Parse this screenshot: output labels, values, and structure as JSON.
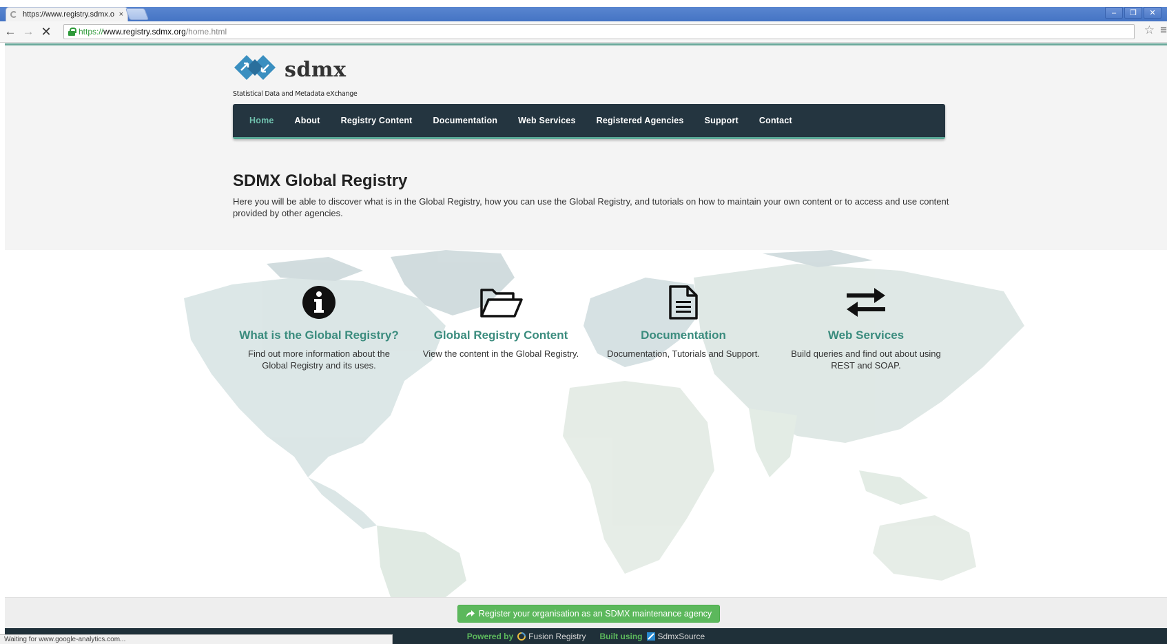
{
  "browser": {
    "tab_title": "https://www.registry.sdmx.o",
    "tab_close": "×",
    "url_scheme": "https://",
    "url_host": "www.registry.sdmx.org",
    "url_path": "/home.html",
    "status_text": "Waiting for www.google-analytics.com..."
  },
  "logo": {
    "word": "sdmx",
    "tagline": "Statistical Data and Metadata eXchange",
    "colors": {
      "mark": "#3a8fc0"
    }
  },
  "nav": {
    "items": [
      {
        "label": "Home",
        "active": true
      },
      {
        "label": "About"
      },
      {
        "label": "Registry Content"
      },
      {
        "label": "Documentation"
      },
      {
        "label": "Web Services"
      },
      {
        "label": "Registered Agencies"
      },
      {
        "label": "Support"
      },
      {
        "label": "Contact"
      }
    ]
  },
  "page": {
    "title": "SDMX Global Registry",
    "intro": "Here you will be able to discover what is in the Global Registry, how you can use the Global Registry, and tutorials on how to maintain your own content or to access and use content provided by other agencies."
  },
  "features": [
    {
      "icon": "info-circle-icon",
      "title": "What is the Global Registry?",
      "desc": "Find out more information about the Global Registry and its uses."
    },
    {
      "icon": "folder-open-icon",
      "title": "Global Registry Content",
      "desc": "View the content in the Global Registry."
    },
    {
      "icon": "document-icon",
      "title": "Documentation",
      "desc": "Documentation, Tutorials and Support."
    },
    {
      "icon": "exchange-arrows-icon",
      "title": "Web Services",
      "desc": "Build queries and find out about using REST and SOAP."
    }
  ],
  "register": {
    "label": "Register your organisation as an SDMX maintenance agency",
    "icon": "share-arrow-icon"
  },
  "footer": {
    "powered_label": "Powered by",
    "powered_name": "Fusion Registry",
    "built_label": "Built using",
    "built_name": "SdmxSource"
  },
  "colors": {
    "accent_teal": "#3b8c7e",
    "nav_bg": "#243540",
    "nav_active": "#6fc0ad",
    "register_green": "#5cb85c",
    "footer_bg": "#1f3039"
  }
}
